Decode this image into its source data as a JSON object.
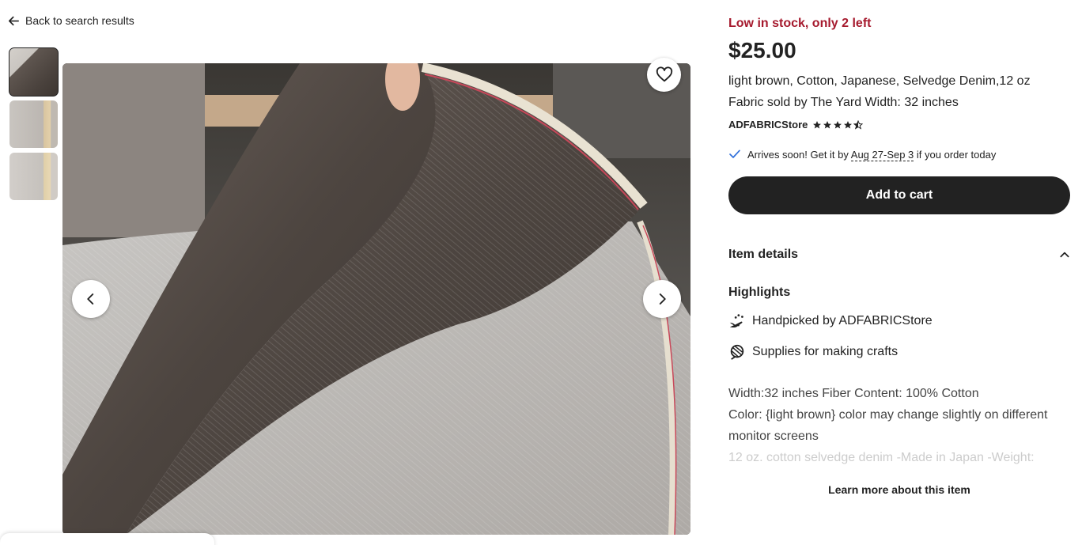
{
  "nav": {
    "back_label": "Back to search results"
  },
  "gallery": {
    "thumbnails": [
      "thumbnail-1",
      "thumbnail-2",
      "thumbnail-3"
    ],
    "active_index": 0
  },
  "product": {
    "stock": "Low in stock, only 2 left",
    "price": "$25.00",
    "title": "light brown, Cotton, Japanese, Selvedge Denim,12 oz Fabric sold by The Yard Width: 32 inches",
    "shop_name": "ADFABRICStore",
    "rating": 4.5,
    "arrival_prefix": "Arrives soon! Get it by ",
    "arrival_dates": "Aug 27-Sep 3",
    "arrival_suffix": " if you order today",
    "add_to_cart": "Add to cart"
  },
  "details": {
    "heading": "Item details",
    "highlights_heading": "Highlights",
    "highlight_1_prefix": "Handpicked by ",
    "highlight_1_shop": "ADFABRICStore",
    "highlight_2": "Supplies for making crafts",
    "desc_line_1": "Width:32 inches Fiber Content: 100% Cotton",
    "desc_line_2": "Color: {light brown} color may change slightly on different monitor screens",
    "desc_line_3": "12 oz. cotton selvedge denim -Made in Japan -Weight:",
    "learn_more": "Learn more about this item"
  },
  "colors": {
    "stock_red": "#a61a2e",
    "primary_dark": "#222222",
    "check_blue": "#2f6fdb"
  }
}
